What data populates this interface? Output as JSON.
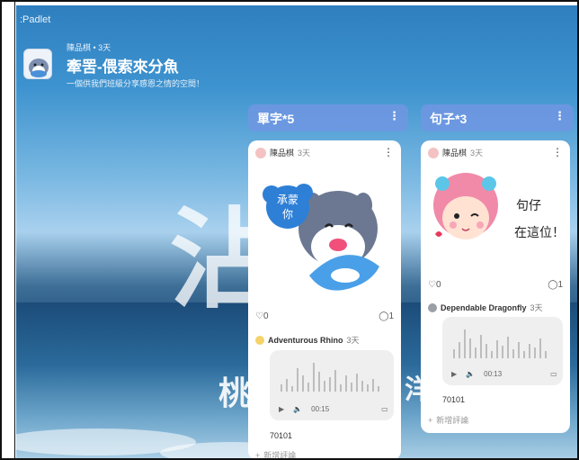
{
  "app": {
    "brand": ":Padlet"
  },
  "header": {
    "meta": "陳品棋 • 3天",
    "title": "牽罟-偎索來分魚",
    "subtitle": "一個供我們班級分享感恩之情的空間！"
  },
  "columns": [
    {
      "title": "單字*5",
      "post": {
        "author": "陳品棋",
        "time": "3天",
        "sticker_text": "承蒙\n你",
        "likes": "0",
        "comments": "1",
        "commenter": "Adventurous Rhino",
        "commenter_time": "3天",
        "audio_time": "00:15",
        "caption": "70101",
        "add_comment": "新增評論"
      }
    },
    {
      "title": "句子*3",
      "post": {
        "author": "陳品棋",
        "time": "3天",
        "sticker_line1": "句仔",
        "sticker_line2": "在這位！",
        "likes": "0",
        "comments": "1",
        "commenter": "Dependable Dragonfly",
        "commenter_time": "3天",
        "audio_time": "00:13",
        "caption": "70101",
        "add_comment": "新增評論"
      }
    }
  ],
  "background": {
    "glyph_left": "沾",
    "glyph_bottom": "桃",
    "glyph_right": "洋"
  },
  "icons": [
    "heart-icon",
    "comment-icon",
    "play-icon",
    "volume-icon",
    "transcript-icon",
    "more-icon"
  ],
  "colors": {
    "column_header": "#6e96e1",
    "accent_pink": "#f4c2c2"
  }
}
